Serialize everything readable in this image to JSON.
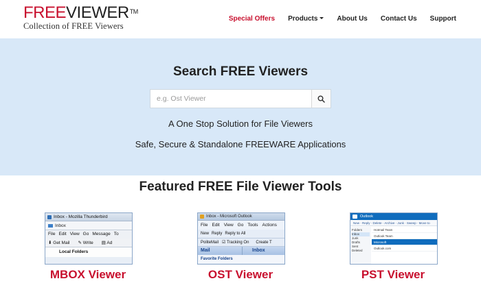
{
  "header": {
    "logo_free": "FREE",
    "logo_viewer": "VIEWER",
    "logo_tm": "TM",
    "logo_tagline": "Collection of FREE Viewers",
    "nav": [
      {
        "label": "Special Offers"
      },
      {
        "label": "Products"
      },
      {
        "label": "About Us"
      },
      {
        "label": "Contact Us"
      },
      {
        "label": "Support"
      }
    ]
  },
  "hero": {
    "title": "Search FREE Viewers",
    "search_placeholder": "e.g. Ost Viewer",
    "line1": "A One Stop Solution for File Viewers",
    "line2": "Safe, Secure & Standalone FREEWARE Applications"
  },
  "featured": {
    "title": "Featured FREE File Viewer Tools",
    "cards": [
      {
        "label": "MBOX Viewer",
        "shot": {
          "title": "Inbox - Mozilla Thunderbird",
          "tab": "Inbox",
          "menu": [
            "File",
            "Edit",
            "View",
            "Go",
            "Message",
            "To"
          ],
          "tools": [
            "Get Mail",
            "Write",
            "Ad"
          ],
          "folders": "Local Folders"
        }
      },
      {
        "label": "OST Viewer",
        "shot": {
          "title": "Inbox - Microsoft Outlook",
          "menu": [
            "File",
            "Edit",
            "View",
            "Go",
            "Tools",
            "Actions"
          ],
          "tools": [
            "New",
            "Reply",
            "Reply to All"
          ],
          "tools2": [
            "PoliteMail",
            "Tracking On",
            "Create T"
          ],
          "mail": "Mail",
          "inbox": "Inbox",
          "favorites": "Favorite Folders"
        }
      },
      {
        "label": "PST Viewer",
        "shot": {
          "app": "Outlook",
          "tools": [
            "New",
            "Reply",
            "Delete",
            "Archive",
            "Junk",
            "Sweep",
            "Move to"
          ],
          "folders": [
            "Folders",
            "Inbox",
            "Junk",
            "Drafts",
            "Sent",
            "Deleted"
          ],
          "rows": [
            "Hotmail Team",
            "Outlook Team",
            "Microsoft",
            "Outlook.com"
          ]
        }
      }
    ]
  }
}
